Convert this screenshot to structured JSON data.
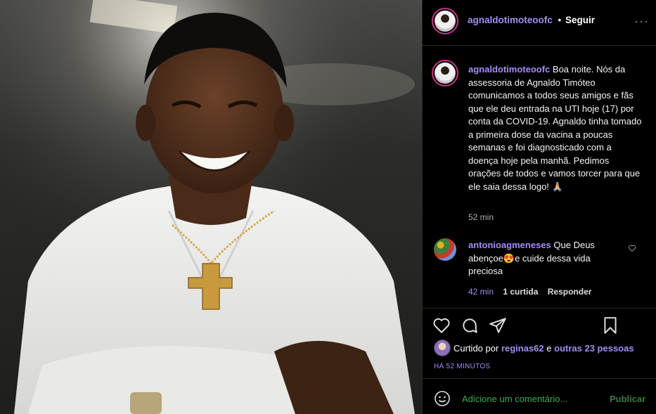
{
  "header": {
    "username": "agnaldotimoteoofc",
    "separator": "•",
    "follow_label": "Seguir",
    "more_icon": "ellipsis-icon"
  },
  "caption": {
    "username": "agnaldotimoteoofc",
    "text": "Boa noite. Nós da assessoria de Agnaldo Timóteo comunicamos a todos seus amigos e fãs que ele deu entrada na UTI hoje (17) por conta da COVID-19. Agnaldo tinha tomado a primeira dose da vacina a poucas semanas e foi diagnosticado com a doença hoje pela manhã. Pedimos orações de todos e vamos torcer para que ele saia dessa logo! 🙏🏼",
    "time": "52 min"
  },
  "comment": {
    "username": "antonioagmeneses",
    "text": "Que Deus abençoe😍e cuide dessa vida preciosa",
    "time": "42 min",
    "likes": "1 curtida",
    "reply_label": "Responder"
  },
  "actions": {
    "icons": [
      "heart-icon",
      "comment-icon",
      "share-icon",
      "bookmark-icon"
    ]
  },
  "likes": {
    "prefix": "Curtido por",
    "user": "reginas62",
    "conj": "e",
    "others": "outras 23 pessoas"
  },
  "timestamp": "HÁ 52 MINUTOS",
  "add_comment": {
    "placeholder": "Adicione um comentário...",
    "post_label": "Publicar"
  },
  "colors": {
    "username": "#a58cf5",
    "post_button": "#3a7a45",
    "divider": "#262626"
  }
}
